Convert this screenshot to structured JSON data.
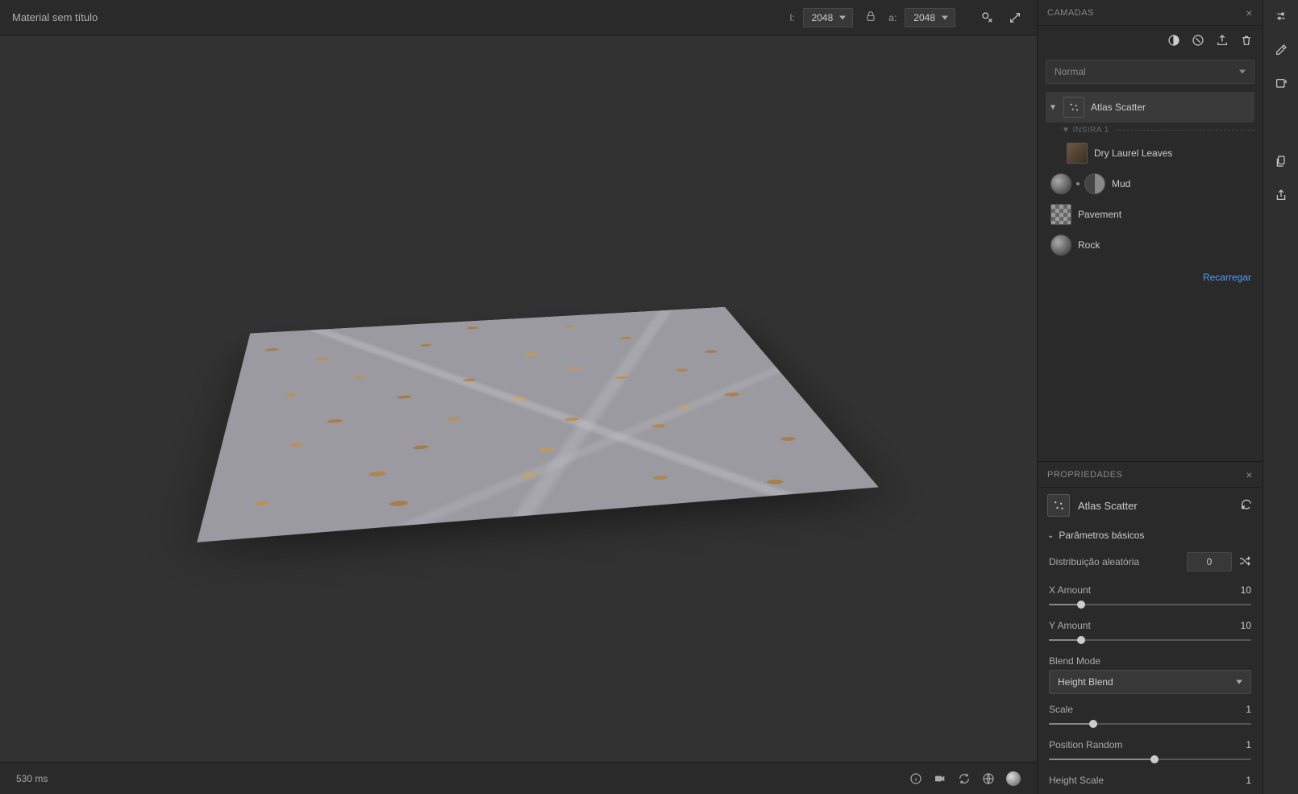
{
  "topbar": {
    "title": "Material sem título",
    "width_label": "l:",
    "width_value": "2048",
    "height_label": "a:",
    "height_value": "2048"
  },
  "layers_panel": {
    "title": "CAMADAS",
    "blend_mode": "Normal",
    "selected_layer": "Atlas Scatter",
    "insert_label": "▼ INSIRA 1",
    "sublayers": [
      {
        "name": "Dry Laurel Leaves"
      },
      {
        "name": "Mud"
      },
      {
        "name": "Pavement"
      },
      {
        "name": "Rock"
      }
    ],
    "reload_label": "Recarregar"
  },
  "properties_panel": {
    "title": "PROPRIEDADES",
    "node_name": "Atlas Scatter",
    "section_basic": "Parâmetros básicos",
    "random_dist_label": "Distribuição aleatória",
    "random_dist_value": "0",
    "x_amount_label": "X Amount",
    "x_amount_value": "10",
    "y_amount_label": "Y Amount",
    "y_amount_value": "10",
    "blend_mode_label": "Blend Mode",
    "blend_mode_value": "Height Blend",
    "scale_label": "Scale",
    "scale_value": "1",
    "position_random_label": "Position Random",
    "position_random_value": "1",
    "height_scale_label": "Height Scale",
    "height_scale_value": "1"
  },
  "statusbar": {
    "render_time": "530 ms"
  }
}
